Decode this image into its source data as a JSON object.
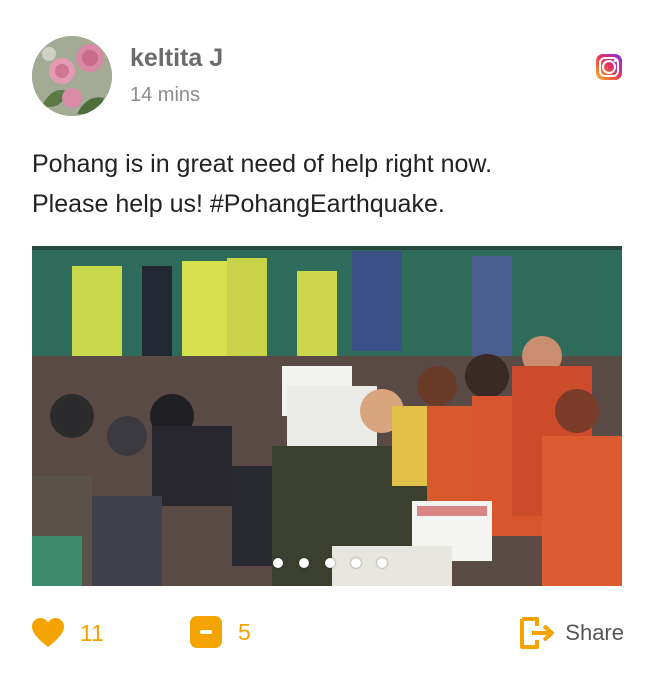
{
  "post": {
    "author": "keltita J",
    "time": "14 mins",
    "text_line1": "Pohang is in great need of help right now.",
    "text_line2": "Please help us! #PohangEarthquake.",
    "source_icon": "instagram-icon",
    "carousel": {
      "slides": 5,
      "active_index": 0
    }
  },
  "actions": {
    "likes": "11",
    "comments": "5",
    "share_label": "Share"
  },
  "colors": {
    "accent": "#f5a300",
    "author": "#6b6b6b",
    "time": "#8c8c8c",
    "text": "#222222"
  }
}
